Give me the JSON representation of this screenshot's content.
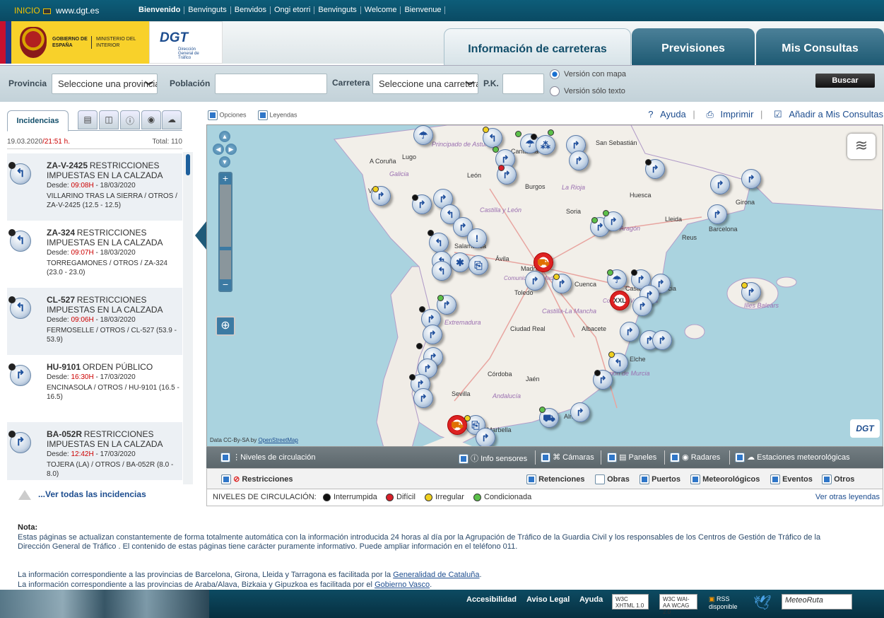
{
  "topbar": {
    "inicio": "INICIO",
    "site": "www.dgt.es",
    "languages": [
      "Bienvenido",
      "Benvinguts",
      "Benvidos",
      "Ongi etorri",
      "Benvinguts",
      "Welcome",
      "Bienvenue"
    ]
  },
  "header": {
    "gov_line1": "GOBIERNO DE ESPAÑA",
    "gov_line2": "MINISTERIO DEL INTERIOR",
    "dgt_mark": "DGT",
    "dgt_sub": "Dirección General de Tráfico",
    "tabs": [
      "Información de carreteras",
      "Previsiones",
      "Mis Consultas"
    ]
  },
  "search": {
    "provincia_label": "Provincia",
    "provincia_value": "Seleccione una provincia",
    "poblacion_label": "Población",
    "poblacion_value": "",
    "carretera_label": "Carretera",
    "carretera_value": "Seleccione una carretera",
    "pk_label": "P.K.",
    "pk_value": "",
    "radio_mapa": "Versión con mapa",
    "radio_texto": "Versión sólo texto",
    "buscar": "Buscar"
  },
  "left": {
    "tab_incidencias": "Incidencias",
    "date": "19.03.2020",
    "time": "/21:51 h.",
    "total": "Total: 110",
    "incidents": [
      {
        "road": "ZA-V-2425",
        "type": "RESTRICCIONES IMPUESTAS EN LA CALZADA",
        "from": "Desde:",
        "hour": "09:08H",
        "date": " - 18/03/2020",
        "place": "VILLARINO TRAS LA SIERRA / OTROS / ZA-V-2425 (12.5 - 12.5)"
      },
      {
        "road": "ZA-324",
        "type": "RESTRICCIONES IMPUESTAS EN LA CALZADA",
        "from": "Desde:",
        "hour": "09:07H",
        "date": " - 18/03/2020",
        "place": "TORREGAMONES / OTROS / ZA-324 (23.0 - 23.0)"
      },
      {
        "road": "CL-527",
        "type": "RESTRICCIONES IMPUESTAS EN LA CALZADA",
        "from": "Desde:",
        "hour": "09:06H",
        "date": " - 18/03/2020",
        "place": "FERMOSELLE / OTROS / CL-527 (53.9 - 53.9)"
      },
      {
        "road": "HU-9101",
        "type": "ORDEN PÚBLICO",
        "from": "Desde:",
        "hour": "16:30H",
        "date": " - 17/03/2020",
        "place": "ENCINASOLA / OTROS / HU-9101 (16.5 - 16.5)"
      },
      {
        "road": "BA-052R",
        "type": "RESTRICCIONES IMPUESTAS EN LA CALZADA",
        "from": "Desde:",
        "hour": "12:42H",
        "date": " - 17/03/2020",
        "place": "TOJERA (LA) / OTROS / BA-052R (8.0 - 8.0)"
      }
    ],
    "ver_todas": "...Ver todas las incidencias"
  },
  "maptools": {
    "opciones": "Opciones",
    "leyendas": "Leyendas",
    "ayuda": "Ayuda",
    "imprimir": "Imprimir",
    "anadir": "Añadir a Mis Consultas"
  },
  "map": {
    "cities": [
      "A Coruña",
      "Lugo",
      "León",
      "Burgos",
      "Vigo",
      "Soria",
      "Huesca",
      "Girona",
      "Lleida",
      "Barcelona",
      "Reus",
      "Salamanca",
      "Ávila",
      "Madrid",
      "Cuenca",
      "Toledo",
      "Castellón",
      "Valencia",
      "Ciudad Real",
      "Albacete",
      "Elche",
      "Córdoba",
      "Jaén",
      "Sevilla",
      "Marbella",
      "Almería",
      "San Sebastián",
      "Cantabria"
    ],
    "regions": [
      "Galicia",
      "Principado de Asturias",
      "Castilla y León",
      "La Rioja",
      "Aragón",
      "Comunidad de Madrid",
      "Castilla-La Mancha",
      "Extremadura",
      "Andalucía",
      "Región de Murcia",
      "Comunitat Valenciana",
      "Illes Balears"
    ],
    "attribution_prefix": "Data CC-By-SA by ",
    "attribution_link": "OpenStreetMap",
    "watermark": "DGT"
  },
  "layers": {
    "niveles": "Niveles de circulación",
    "info_sensores": "Info sensores",
    "camaras": "Cámaras",
    "paneles": "Paneles",
    "radares": "Radares",
    "estaciones": "Estaciones meteorológicas",
    "restricciones": "Restricciones",
    "retenciones": "Retenciones",
    "obras": "Obras",
    "puertos": "Puertos",
    "meteorologicos": "Meteorológicos",
    "eventos": "Eventos",
    "otros": "Otros"
  },
  "legend": {
    "title": "NIVELES DE CIRCULACIÓN:",
    "interrumpida": "Interrumpida",
    "dificil": "Difícil",
    "irregular": "Irregular",
    "condicionada": "Condicionada",
    "ver_otras": "Ver otras leyendas",
    "colors": {
      "interrumpida": "#111111",
      "dificil": "#d8202a",
      "irregular": "#f0d020",
      "condicionada": "#5cc04a"
    }
  },
  "nota": {
    "title": "Nota:",
    "text": "Estas páginas se actualizan constantemente de forma totalmente automática con la información introducida 24 horas al día por la Agrupación de Tráfico de la Guardia Civil y los responsables de los Centros de Gestión de Tráfico de la Dirección General de Tráfico . El contenido de estas páginas tiene carácter puramente informativo. Puede ampliar información en el teléfono 011.",
    "line1_prefix": "La información correspondiente a las provincias de Barcelona, Girona, Lleida y Tarragona es facilitada por la ",
    "line1_link": "Generalidad de Cataluña",
    "line2_prefix": "La información correspondiente a las provincias de Araba/Alava, Bizkaia y Gipuzkoa es facilitada por el ",
    "line2_link": "Gobierno Vasco",
    "period": "."
  },
  "footer": {
    "accesibilidad": "Accesibilidad",
    "aviso": "Aviso Legal",
    "ayuda": "Ayuda",
    "xhtml": "W3C XHTML 1.0",
    "wai": "W3C WAI-AA WCAG 2.0",
    "rss": "RSS disponible",
    "meteoruta": "MeteoRuta"
  }
}
